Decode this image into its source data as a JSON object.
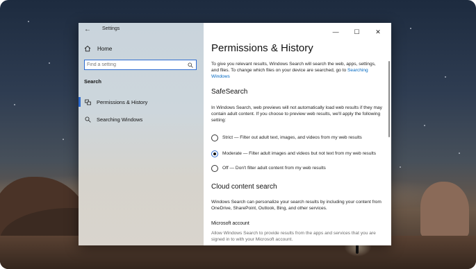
{
  "window": {
    "app_title": "Settings",
    "controls": {
      "minimize": "—",
      "maximize": "☐",
      "close": "✕"
    }
  },
  "sidebar": {
    "home_label": "Home",
    "search": {
      "placeholder": "Find a setting",
      "value": ""
    },
    "section_heading": "Search",
    "items": [
      {
        "label": "Permissions & History",
        "icon": "permissions-icon",
        "selected": true
      },
      {
        "label": "Searching Windows",
        "icon": "search-icon",
        "selected": false
      }
    ]
  },
  "main": {
    "title": "Permissions & History",
    "intro_text": "To give you relevant results, Windows Search will search the web, apps, settings, and files. To change which files on your device are searched, go to",
    "intro_link": "Searching Windows",
    "safesearch": {
      "heading": "SafeSearch",
      "description": "In Windows Search, web previews will not automatically load web results if they may contain adult content. If you choose to preview web results, we'll apply the following setting:",
      "options": [
        {
          "label": "Strict — Filter out adult text, images, and videos from my web results",
          "checked": false
        },
        {
          "label": "Moderate — Filter adult images and videos but not text from my web results",
          "checked": true
        },
        {
          "label": "Off — Don't filter adult content from my web results",
          "checked": false
        }
      ]
    },
    "cloud": {
      "heading": "Cloud content search",
      "description": "Windows Search can personalize your search results by including your content from OneDrive, SharePoint, Outlook, Bing, and other services.",
      "account_heading": "Microsoft account",
      "account_description": "Allow Windows Search to provide results from the apps and services that you are signed in to with your Microsoft account."
    }
  },
  "colors": {
    "accent": "#2d6bd1",
    "link": "#0067c0"
  }
}
